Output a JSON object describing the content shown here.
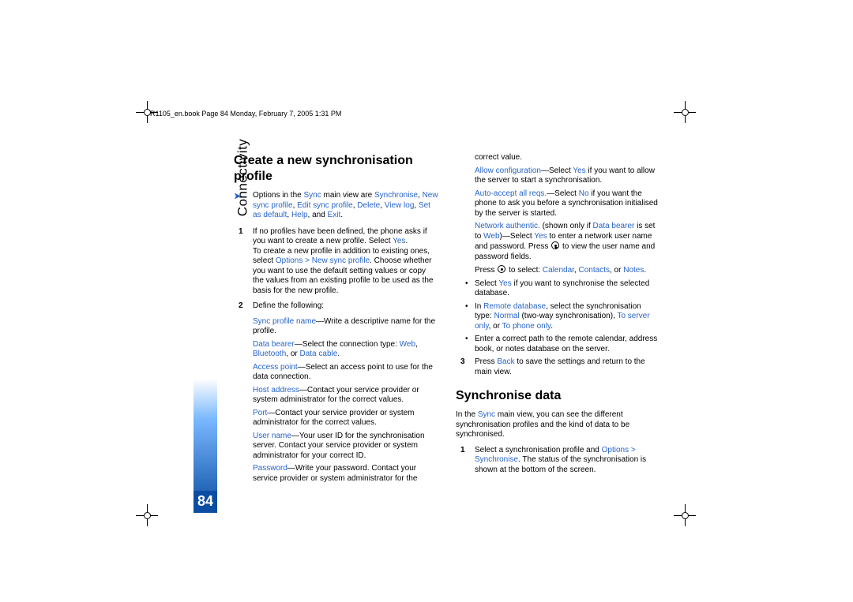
{
  "header": "R1105_en.book  Page 84  Monday, February 7, 2005  1:31 PM",
  "side_label": "Connectivity",
  "page_number": "84",
  "h_create": "Create a new synchronisation profile",
  "tip_pre": "Options in the ",
  "tip_sync": "Sync",
  "tip_mid": " main view are ",
  "tip_o1": "Synchronise",
  "tip_o2": "New sync profile",
  "tip_o3": "Edit sync profile",
  "tip_o4": "Delete",
  "tip_o5": "View log",
  "tip_o6": "Set as default",
  "tip_o7": "Help",
  "tip_and": ", and ",
  "tip_o8": "Exit",
  "s1a": "If no profiles have been defined, the phone asks if you want to create a new profile. Select ",
  "s_yes": "Yes",
  "s1b": "To create a new profile in addition to existing ones, select ",
  "s_opt_new": "Options > New sync profile",
  "s1c": ". Choose whether you want to use the default setting values or copy the values from an existing profile to be used as the basis for the new profile.",
  "s2a": "Define the following:",
  "s_spn": "Sync profile name",
  "s_spn_t": "—Write a descriptive name for the profile.",
  "s_db": "Data bearer",
  "s_db_t1": "—Select the connection type: ",
  "s_web": "Web",
  "s_bt": "Bluetooth",
  "s_or": ", or ",
  "s_dc": "Data cable",
  "s_ap": "Access point",
  "s_ap_t": "—Select an access point to use for the data connection.",
  "s_ha": "Host address",
  "s_ha_t": "—Contact your service provider or system administrator for the correct values.",
  "s_port": "Port",
  "s_port_t": "—Contact your service provider or system administrator for the correct values.",
  "s_un": "User name",
  "s_un_t": "—Your user ID for the synchronisation server. Contact your service provider or system administrator for your correct ID.",
  "s_pw": "Password",
  "s_pw_t": "—Write your password. Contact your service provider or system administrator for the correct value.",
  "s_ac": "Allow configuration",
  "s_ac_t1": "—Select ",
  "s_ac_t2": " if you want to allow the server to start a synchronisation.",
  "s_aar": "Auto-accept all reqs.",
  "s_aar_t1": "—Select ",
  "s_no": "No",
  "s_aar_t2": " if you want the phone to ask you before a synchronisation initialised by the server is started.",
  "s_na": "Network authentic.",
  "s_na_t1": " (shown only if ",
  "s_na_t2": " is set to ",
  "s_na_t3": ")—Select ",
  "s_na_t4": " to enter a network user name and password. Press ",
  "s_na_t5": " to view the user name and password fields.",
  "press_t": "Press ",
  "press_t2": " to select: ",
  "cal": "Calendar",
  "con": "Contacts",
  "notes": "Notes",
  "b1a": "Select ",
  "b1b": " if you want to synchronise the selected database.",
  "b2a": "In ",
  "rdb": "Remote database",
  "b2b": ", select the synchronisation type: ",
  "normal": "Normal",
  "b2c": " (two-way synchronisation), ",
  "tso": "To server only",
  "tpo": "To phone only",
  "b3": "Enter a correct path to the remote calendar, address book, or notes database on the server.",
  "s3a": "Press ",
  "back": "Back",
  "s3b": " to save the settings and return to the main view.",
  "h_sync": "Synchronise data",
  "sd_intro1": "In the ",
  "sd_intro2": " main view, you can see the different synchronisation profiles and the kind of data to be synchronised.",
  "sd1a": "Select a synchronisation profile and ",
  "opt_sync": "Options > Synchronise",
  "sd1b": ". The status of the synchronisation is shown at the bottom of the screen."
}
